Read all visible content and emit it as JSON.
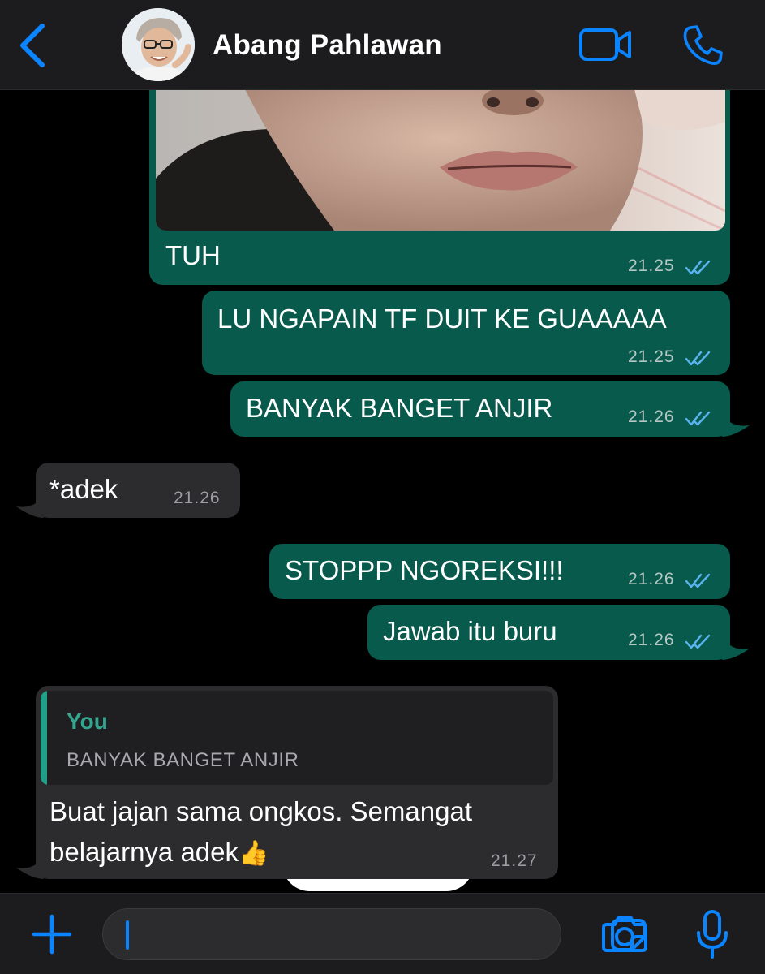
{
  "header": {
    "contact_name": "Abang Pahlawan",
    "icons": [
      "chevron-left-icon",
      "avatar",
      "video-camera-icon",
      "phone-icon"
    ],
    "accent_color": "#0a84ff"
  },
  "messages": [
    {
      "direction": "outgoing",
      "type": "image",
      "caption": "TUH",
      "time": "21.25",
      "status": "read"
    },
    {
      "direction": "outgoing",
      "text": "LU NGAPAIN TF DUIT KE GUAAAAA",
      "time": "21.25",
      "status": "read"
    },
    {
      "direction": "outgoing",
      "text": "BANYAK BANGET ANJIR",
      "time": "21.26",
      "status": "read"
    },
    {
      "direction": "incoming",
      "text": "*adek",
      "time": "21.26"
    },
    {
      "direction": "outgoing",
      "text": "STOPPP NGOREKSI!!!",
      "time": "21.26",
      "status": "read"
    },
    {
      "direction": "outgoing",
      "text": "Jawab itu buru",
      "time": "21.26",
      "status": "read"
    },
    {
      "direction": "incoming",
      "reply_to": {
        "author": "You",
        "text": "BANYAK BANGET ANJIR"
      },
      "text_line1": "Buat jajan sama ongkos. Semangat",
      "text_line2": "belajarnya adek",
      "emoji": "👍",
      "time": "21.27"
    }
  ],
  "input": {
    "value": "",
    "icons": [
      "plus-icon",
      "sticker-icon",
      "camera-icon",
      "microphone-icon"
    ]
  },
  "colors": {
    "outgoing_bubble": "#075a4c",
    "incoming_bubble": "#2c2c2e",
    "read_ticks": "#5ab4f0",
    "quote_author": "#34a58f"
  }
}
